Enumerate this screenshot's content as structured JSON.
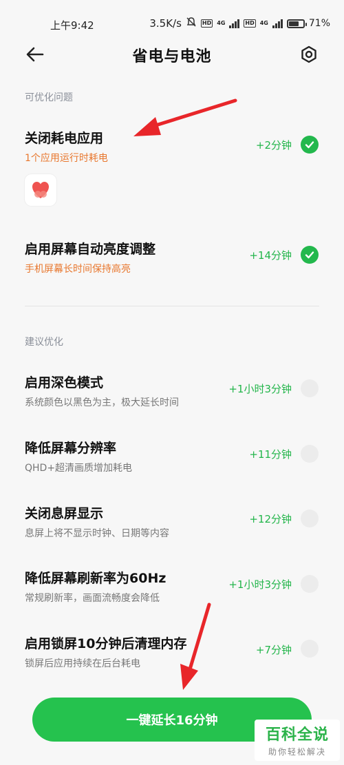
{
  "status_bar": {
    "time": "上午9:42",
    "speed": "3.5K/s",
    "network1": "4G",
    "network2": "4G",
    "hd1": "HD",
    "hd2": "HD",
    "battery_level": 71,
    "battery_text": "71%"
  },
  "header": {
    "title": "省电与电池",
    "back_icon": "back-arrow-icon",
    "settings_icon": "settings-icon"
  },
  "sections": {
    "optimizable": "可优化问题",
    "suggested": "建议优化"
  },
  "optimizable_items": [
    {
      "title": "关闭耗电应用",
      "subtitle": "1个应用运行时耗电",
      "gain": "+2分钟",
      "checked": true
    },
    {
      "title": "启用屏幕自动亮度调整",
      "subtitle": "手机屏幕长时间保持高亮",
      "gain": "+14分钟",
      "checked": true
    }
  ],
  "suggested_items": [
    {
      "title": "启用深色模式",
      "subtitle": "系统颜色以黑色为主，极大延长时间",
      "gain": "+1小时3分钟",
      "checked": false
    },
    {
      "title": "降低屏幕分辨率",
      "subtitle": "QHD+超清画质增加耗电",
      "gain": "+11分钟",
      "checked": false
    },
    {
      "title": "关闭息屏显示",
      "subtitle": "息屏上将不显示时钟、日期等内容",
      "gain": "+12分钟",
      "checked": false
    },
    {
      "title": "降低屏幕刷新率为60Hz",
      "subtitle": "常规刷新率，画面流畅度会降低",
      "gain": "+1小时3分钟",
      "checked": false
    },
    {
      "title": "启用锁屏10分钟后清理内存",
      "subtitle": "锁屏后应用持续在后台耗电",
      "gain": "+7分钟",
      "checked": false
    }
  ],
  "cta": {
    "label": "一键延长16分钟"
  },
  "watermark": {
    "title": "百科全说",
    "subtitle": "助你轻松解决"
  },
  "colors": {
    "accent": "#23b84d",
    "orange": "#e8772e",
    "arrow": "#e8262a"
  }
}
